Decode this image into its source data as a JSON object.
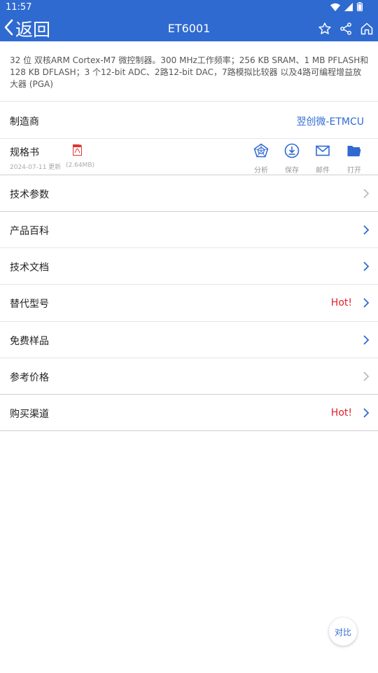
{
  "status_bar": {
    "time": "11:57"
  },
  "header": {
    "back_label": "返回",
    "title": "ET6001"
  },
  "description": "32 位 双核ARM Cortex-M7 微控制器。300 MHz工作频率；256 KB  SRAM、1 MB PFLASH和128 KB DFLASH；3 个12-bit ADC、2路12-bit DAC，7路模拟比较器 以及4路可编程增益放大器 (PGA)",
  "manufacturer": {
    "label": "制造商",
    "value": "翌创微-ETMCU"
  },
  "spec": {
    "label": "规格书",
    "date": "2024-07-11 更新",
    "size": "(2.64MB)",
    "actions": [
      {
        "label": "分析",
        "icon": "analysis-icon"
      },
      {
        "label": "保存",
        "icon": "download-icon"
      },
      {
        "label": "邮件",
        "icon": "mail-icon"
      },
      {
        "label": "打开",
        "icon": "folder-icon"
      }
    ]
  },
  "menu": [
    {
      "label": "技术参数",
      "hot": "",
      "enabled": false
    },
    {
      "label": "产品百科",
      "hot": "",
      "enabled": true
    },
    {
      "label": "技术文档",
      "hot": "",
      "enabled": true
    },
    {
      "label": "替代型号",
      "hot": "Hot!",
      "enabled": true
    },
    {
      "label": "免费样品",
      "hot": "",
      "enabled": true
    },
    {
      "label": "参考价格",
      "hot": "",
      "enabled": false
    },
    {
      "label": "购买渠道",
      "hot": "Hot!",
      "enabled": true
    }
  ],
  "compare_label": "对比",
  "colors": {
    "primary": "#2f6ad0",
    "hot": "#e0202a",
    "disabled": "#bbbbbb"
  }
}
